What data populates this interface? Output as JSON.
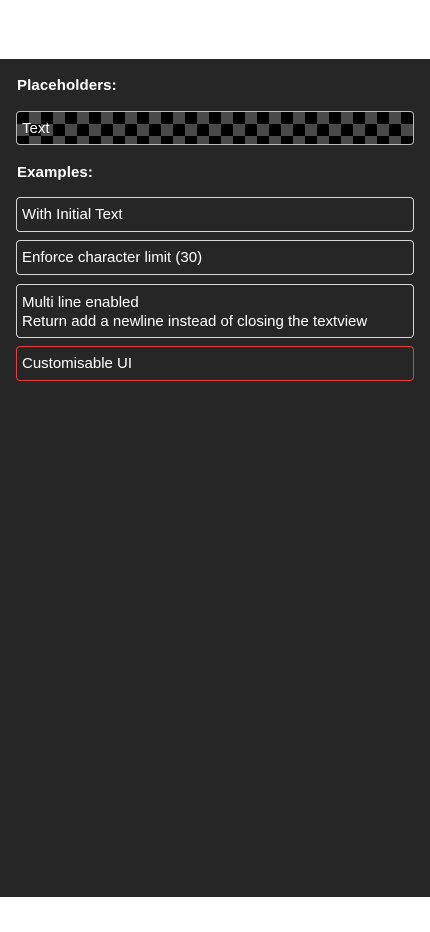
{
  "sections": {
    "placeholders_title": "Placeholders:",
    "examples_title": "Examples:"
  },
  "placeholder_field": {
    "value": "Text"
  },
  "examples": {
    "initial_text": "With Initial Text",
    "char_limit": "Enforce character limit (30)",
    "multiline_line1": "Multi line enabled",
    "multiline_line2": "Return add a newline instead of closing the textview",
    "customisable": "Customisable UI"
  },
  "colors": {
    "panel_background": "#262626",
    "field_border": "#d6d6d6",
    "accent_border": "#e33d3d",
    "text": "#ffffff"
  }
}
